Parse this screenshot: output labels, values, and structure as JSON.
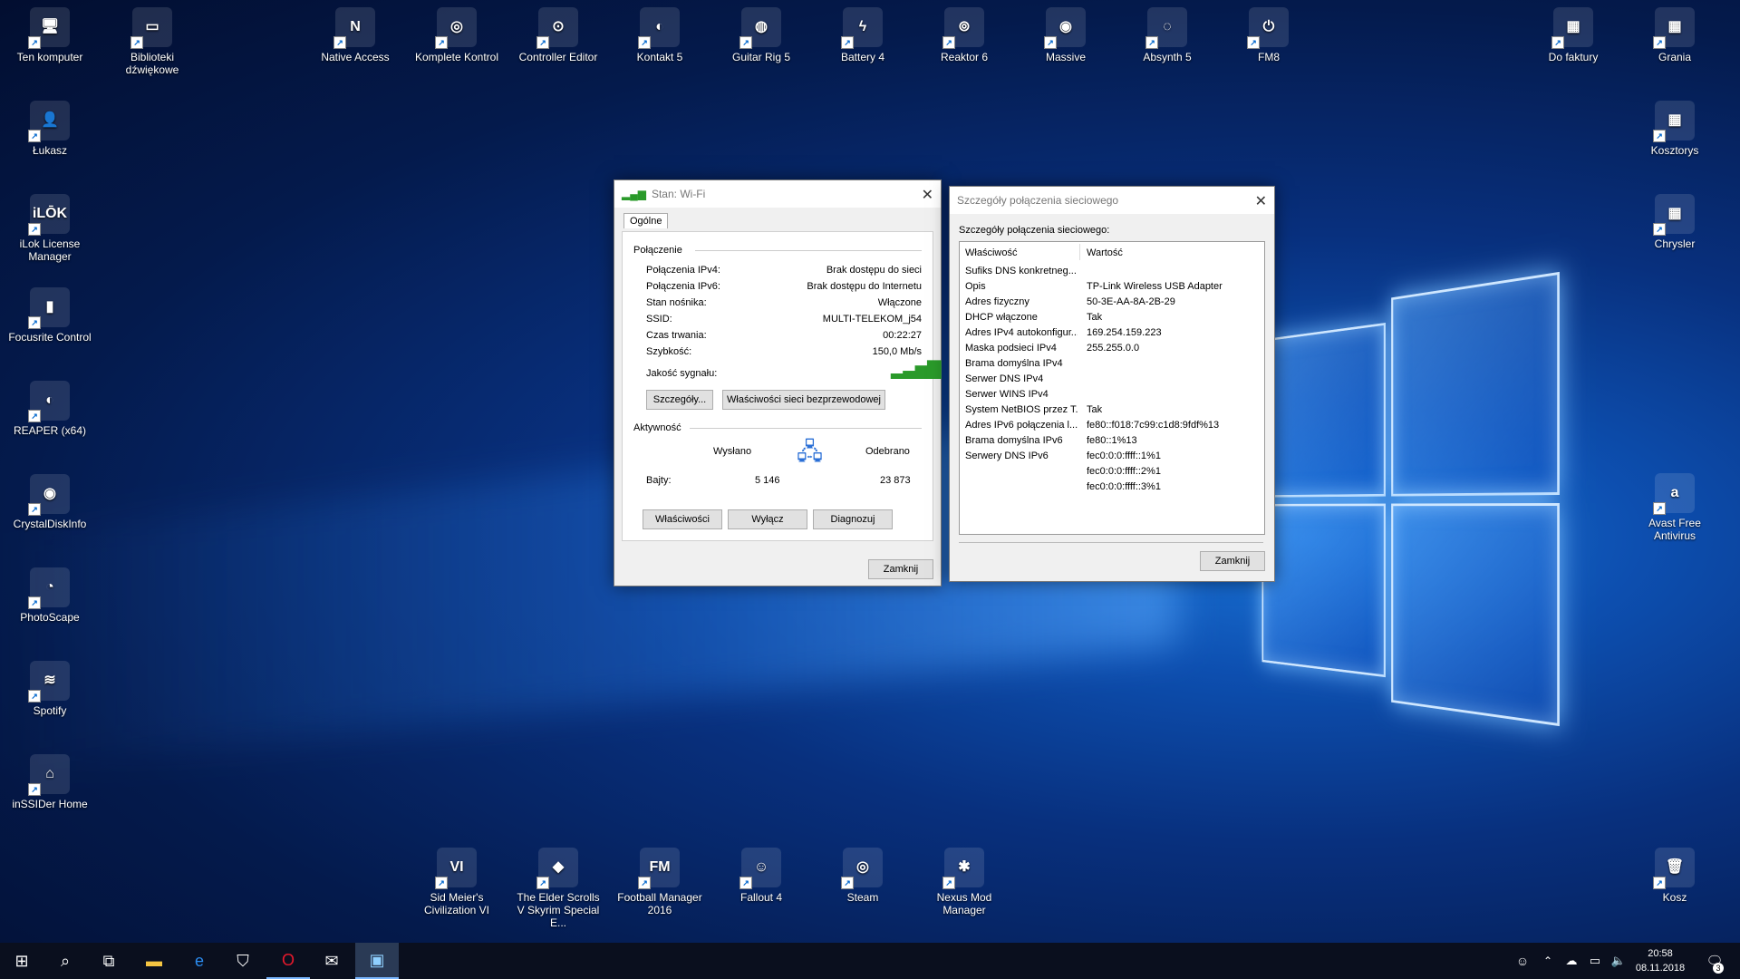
{
  "desktop_left": [
    {
      "label": "Ten komputer",
      "glyph": "🖥"
    },
    {
      "label": "Łukasz",
      "glyph": "👤"
    },
    {
      "label": "iLok License Manager",
      "glyph": "iLŌK"
    },
    {
      "label": "Focusrite Control",
      "glyph": "▮"
    },
    {
      "label": "REAPER (x64)",
      "glyph": "◐"
    },
    {
      "label": "CrystalDiskInfo",
      "glyph": "◉"
    },
    {
      "label": "PhotoScape",
      "glyph": "◔"
    },
    {
      "label": "Spotify",
      "glyph": "≋"
    },
    {
      "label": "inSSIDer Home",
      "glyph": "⌂"
    }
  ],
  "desktop_col2": [
    {
      "label": "Biblioteki dźwiękowe",
      "glyph": "▭"
    }
  ],
  "desktop_top": [
    {
      "label": "Native Access",
      "glyph": "N"
    },
    {
      "label": "Komplete Kontrol",
      "glyph": "◎"
    },
    {
      "label": "Controller Editor",
      "glyph": "⊙"
    },
    {
      "label": "Kontakt 5",
      "glyph": "◐"
    },
    {
      "label": "Guitar Rig 5",
      "glyph": "◍"
    },
    {
      "label": "Battery 4",
      "glyph": "ϟ"
    },
    {
      "label": "Reaktor 6",
      "glyph": "⊚"
    },
    {
      "label": "Massive",
      "glyph": "◉"
    },
    {
      "label": "Absynth 5",
      "glyph": "◌"
    },
    {
      "label": "FM8",
      "glyph": "⏻"
    }
  ],
  "desktop_right": [
    {
      "label": "Do faktury",
      "glyph": "▦"
    },
    {
      "label": "Grania",
      "glyph": "▦"
    },
    {
      "label": "Kosztorys",
      "glyph": "▦"
    },
    {
      "label": "Chrysler",
      "glyph": "▦"
    },
    {
      "label": "Avast Free Antivirus",
      "glyph": "a"
    },
    {
      "label": "Kosz",
      "glyph": "🗑"
    }
  ],
  "desktop_bottom": [
    {
      "label": "Sid Meier's Civilization VI",
      "glyph": "VI"
    },
    {
      "label": "The Elder Scrolls V Skyrim Special E...",
      "glyph": "◆"
    },
    {
      "label": "Football Manager 2016",
      "glyph": "FM"
    },
    {
      "label": "Fallout 4",
      "glyph": "☺"
    },
    {
      "label": "Steam",
      "glyph": "◎"
    },
    {
      "label": "Nexus Mod Manager",
      "glyph": "✱"
    }
  ],
  "wifi": {
    "title": "Stan: Wi-Fi",
    "tab": "Ogólne",
    "section_connection": "Połączenie",
    "rows": [
      {
        "k": "Połączenia IPv4:",
        "v": "Brak dostępu do sieci"
      },
      {
        "k": "Połączenia IPv6:",
        "v": "Brak dostępu do Internetu"
      },
      {
        "k": "Stan nośnika:",
        "v": "Włączone"
      },
      {
        "k": "SSID:",
        "v": "MULTI-TELEKOM_j54"
      },
      {
        "k": "Czas trwania:",
        "v": "00:22:27"
      },
      {
        "k": "Szybkość:",
        "v": "150,0 Mb/s"
      }
    ],
    "signal_label": "Jakość sygnału:",
    "details_btn": "Szczegóły...",
    "wireless_btn": "Właściwości sieci bezprzewodowej",
    "section_activity": "Aktywność",
    "sent": "Wysłano",
    "received": "Odebrano",
    "bytes_label": "Bajty:",
    "bytes_sent": "5 146",
    "bytes_received": "23 873",
    "props_btn": "Właściwości",
    "disable_btn": "Wyłącz",
    "diagnose_btn": "Diagnozuj",
    "close_btn": "Zamknij"
  },
  "details": {
    "title": "Szczegóły połączenia sieciowego",
    "heading": "Szczegóły połączenia sieciowego:",
    "col_prop": "Właściwość",
    "col_val": "Wartość",
    "rows": [
      {
        "k": "Sufiks DNS konkretneg...",
        "v": ""
      },
      {
        "k": "Opis",
        "v": "TP-Link Wireless USB Adapter"
      },
      {
        "k": "Adres fizyczny",
        "v": "50-3E-AA-8A-2B-29"
      },
      {
        "k": "DHCP włączone",
        "v": "Tak"
      },
      {
        "k": "Adres IPv4 autokonfigur...",
        "v": "169.254.159.223"
      },
      {
        "k": "Maska podsieci IPv4",
        "v": "255.255.0.0"
      },
      {
        "k": "Brama domyślna IPv4",
        "v": ""
      },
      {
        "k": "Serwer DNS IPv4",
        "v": ""
      },
      {
        "k": "Serwer WINS IPv4",
        "v": ""
      },
      {
        "k": "System NetBIOS przez T...",
        "v": "Tak"
      },
      {
        "k": "Adres IPv6 połączenia l...",
        "v": "fe80::f018:7c99:c1d8:9fdf%13"
      },
      {
        "k": "Brama domyślna IPv6",
        "v": "fe80::1%13"
      },
      {
        "k": "Serwery DNS IPv6",
        "v": "fec0:0:0:ffff::1%1"
      },
      {
        "k": "",
        "v": "fec0:0:0:ffff::2%1"
      },
      {
        "k": "",
        "v": "fec0:0:0:ffff::3%1"
      }
    ],
    "close_btn": "Zamknij"
  },
  "taskbar": {
    "time": "20:58",
    "date": "08.11.2018",
    "notif_count": "3"
  }
}
